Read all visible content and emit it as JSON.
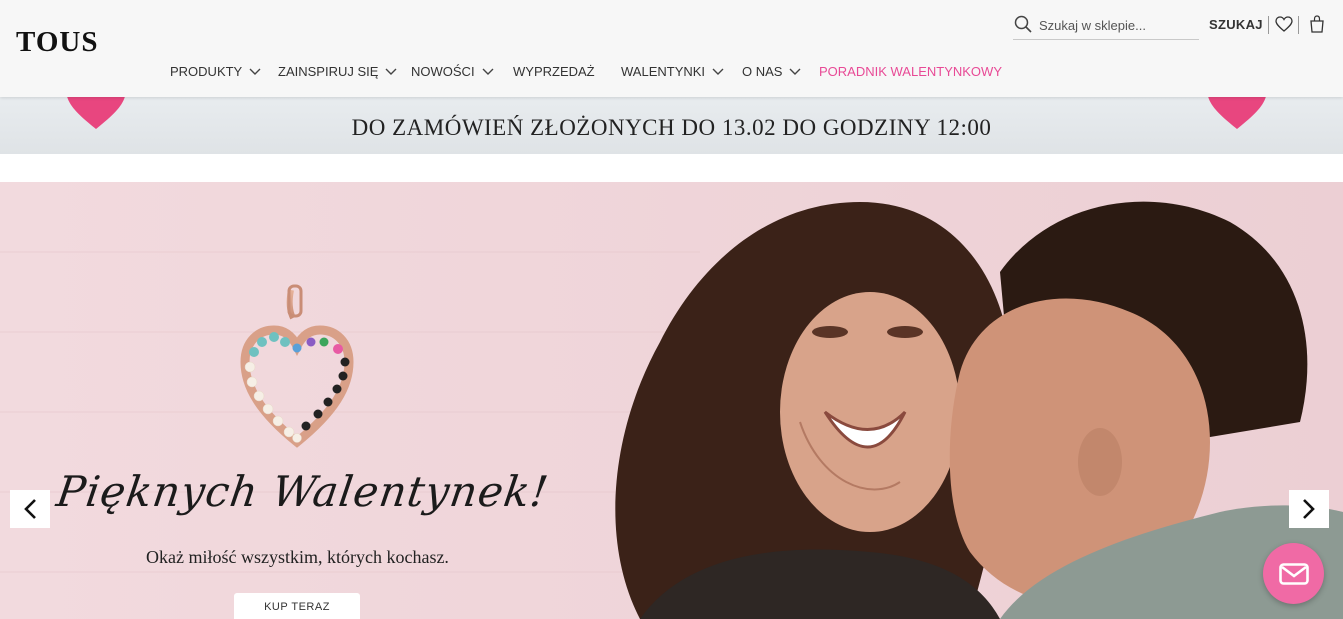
{
  "header": {
    "logo": "TOUS",
    "search_placeholder": "Szukaj w sklepie...",
    "search_button": "SZUKAJ"
  },
  "nav": {
    "items": [
      {
        "label": "PRODUKTY"
      },
      {
        "label": "ZAINSPIRUJ SIĘ"
      },
      {
        "label": "NOWOŚCI"
      },
      {
        "label": "WYPRZEDAŻ"
      },
      {
        "label": "WALENTYNKI"
      },
      {
        "label": "O NAS"
      },
      {
        "label": "PORADNIK WALENTYNKOWY"
      }
    ]
  },
  "promo": {
    "line": "DO ZAMÓWIEŃ ZŁOŻONYCH DO 13.02 DO GODZINY 12:00"
  },
  "hero": {
    "title": "Pięknych Walentynek!",
    "subtitle": "Okaż miłość wszystkim, których kochasz.",
    "cta": "KUP TERAZ"
  },
  "colors": {
    "accent_pink": "#e84a96",
    "heart_pink": "#e8467f",
    "hero_bg": "#f1d6da",
    "chat_button": "#f06aa5"
  },
  "icons": {
    "search": "search-icon",
    "wishlist": "heart-icon",
    "cart": "shopping-bag-icon",
    "prev": "chevron-left-icon",
    "next": "chevron-right-icon",
    "chat": "mail-icon"
  }
}
